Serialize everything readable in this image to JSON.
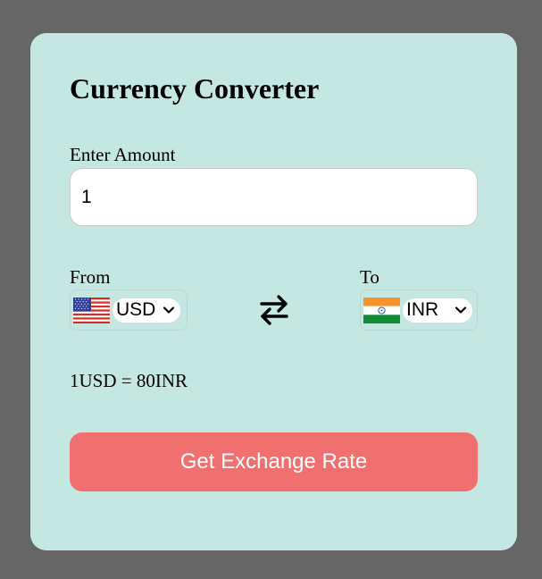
{
  "title": "Currency Converter",
  "amount": {
    "label": "Enter Amount",
    "value": "1"
  },
  "from": {
    "label": "From",
    "currency": "USD",
    "flag": "us-flag-icon"
  },
  "to": {
    "label": "To",
    "currency": "INR",
    "flag": "india-flag-icon"
  },
  "swap_icon": "swap-arrows-icon",
  "rate": {
    "text": "1USD = 80INR"
  },
  "button": {
    "label": "Get Exchange Rate"
  },
  "colors": {
    "page_background": "#666666",
    "card_background": "#c5e7e1",
    "button_background": "#f07070",
    "button_text": "#ffffff"
  }
}
